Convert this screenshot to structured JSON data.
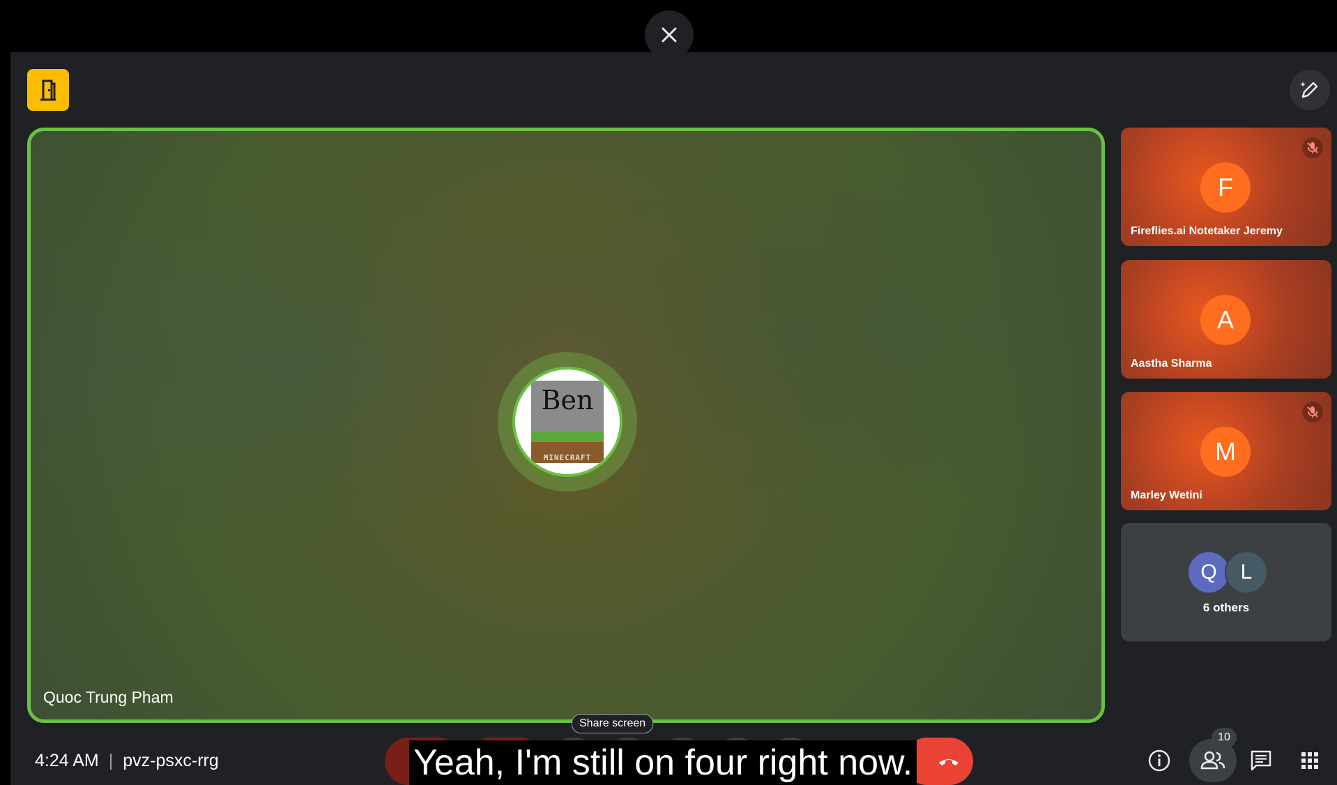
{
  "main_tile": {
    "participant_name": "Quoc Trung Pham",
    "avatar_card_name": "Ben",
    "avatar_card_brand": "MINECRAFT"
  },
  "side_tiles": [
    {
      "initial": "F",
      "name": "Fireflies.ai Notetaker Jeremy",
      "muted": true
    },
    {
      "initial": "A",
      "name": "Aastha Sharma",
      "muted": false
    },
    {
      "initial": "M",
      "name": "Marley Wetini",
      "muted": true
    }
  ],
  "others_tile": {
    "avatars": [
      "Q",
      "L"
    ],
    "label": "6 others"
  },
  "tooltip": {
    "share_screen": "Share screen"
  },
  "meeting": {
    "time": "4:24 AM",
    "code": "pvz-psxc-rrg"
  },
  "caption": {
    "text": "Yeah, I'm still on four right now."
  },
  "people": {
    "count": "10"
  },
  "colors": {
    "speaker_border": "#6ac045",
    "leave_badge": "#fbbc04",
    "avatar_orange": "#ff6d1f",
    "end_call": "#ea4335"
  },
  "icons": {
    "close": "close-icon",
    "leave": "door-icon",
    "edit": "pencil-sparkle-icon",
    "mute": "mic-off-icon",
    "info": "info-icon",
    "people": "people-icon",
    "chat": "chat-icon",
    "activities": "apps-grid-icon"
  }
}
